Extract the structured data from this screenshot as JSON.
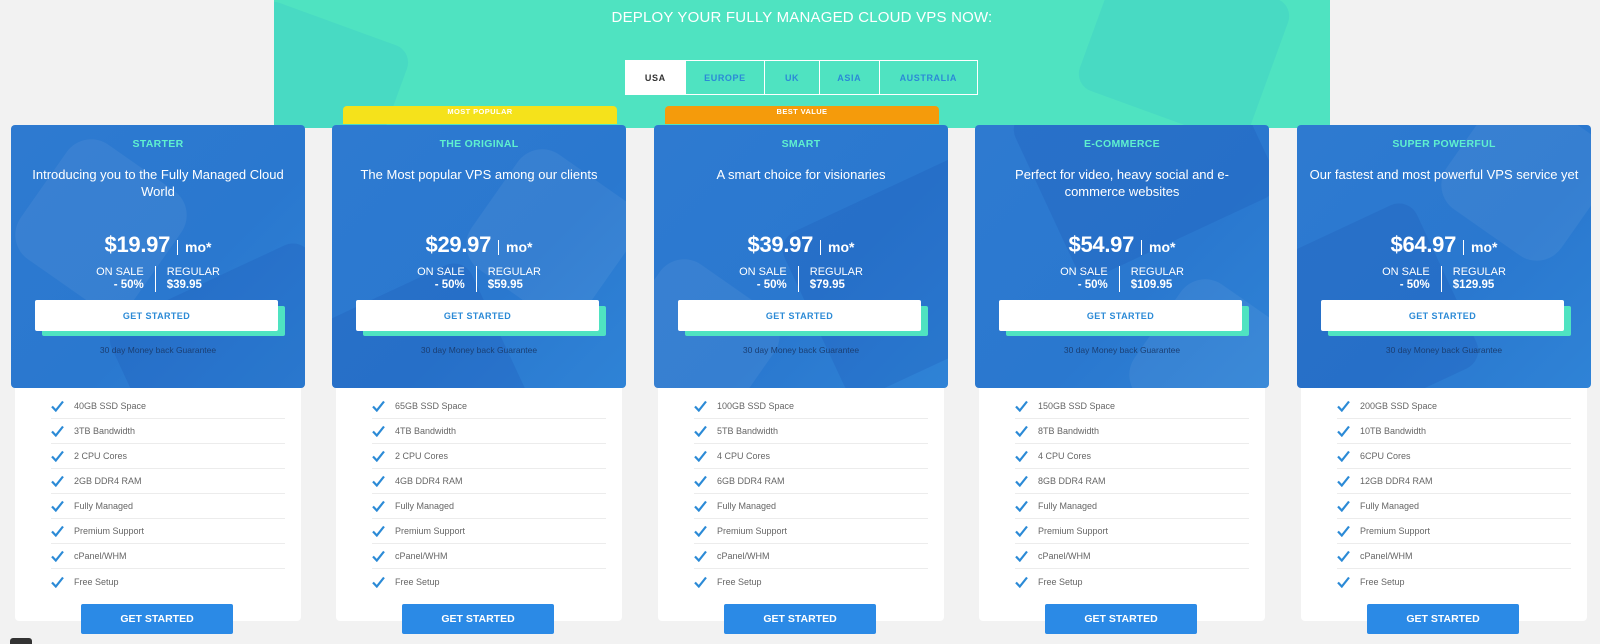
{
  "hero": {
    "title": "DEPLOY YOUR FULLY MANAGED CLOUD VPS NOW:",
    "tabs": [
      {
        "label": "USA",
        "active": true
      },
      {
        "label": "EUROPE",
        "active": false
      },
      {
        "label": "UK",
        "active": false
      },
      {
        "label": "ASIA",
        "active": false
      },
      {
        "label": "AUSTRALIA",
        "active": false
      }
    ]
  },
  "ribbons": {
    "popular": "MOST POPULAR",
    "best": "BEST VALUE"
  },
  "plans": [
    {
      "name": "STARTER",
      "tagline": "Introducing you to the Fully Managed Cloud World",
      "price": "$19.97",
      "mo": "mo*",
      "sale_label": "ON SALE",
      "sale_value": "- 50%",
      "regular_label": "REGULAR",
      "regular_value": "$39.95",
      "cta": "GET STARTED",
      "guarantee": "30 day Money back Guarantee",
      "features": [
        "40GB SSD Space",
        "3TB Bandwidth",
        "2 CPU Cores",
        "2GB DDR4 RAM",
        "Fully Managed",
        "Premium Support",
        "cPanel/WHM",
        "Free Setup"
      ],
      "bottom_cta": "GET STARTED"
    },
    {
      "name": "THE ORIGINAL",
      "tagline": "The Most popular VPS among our clients",
      "price": "$29.97",
      "mo": "mo*",
      "sale_label": "ON SALE",
      "sale_value": "- 50%",
      "regular_label": "REGULAR",
      "regular_value": "$59.95",
      "cta": "GET STARTED",
      "guarantee": "30 day Money back Guarantee",
      "features": [
        "65GB SSD Space",
        "4TB Bandwidth",
        "2 CPU Cores",
        "4GB DDR4 RAM",
        "Fully Managed",
        "Premium Support",
        "cPanel/WHM",
        "Free Setup"
      ],
      "bottom_cta": "GET STARTED"
    },
    {
      "name": "SMART",
      "tagline": "A smart choice for visionaries",
      "price": "$39.97",
      "mo": "mo*",
      "sale_label": "ON SALE",
      "sale_value": "- 50%",
      "regular_label": "REGULAR",
      "regular_value": "$79.95",
      "cta": "GET STARTED",
      "guarantee": "30 day Money back Guarantee",
      "features": [
        "100GB SSD Space",
        "5TB Bandwidth",
        "4 CPU Cores",
        "6GB DDR4 RAM",
        "Fully Managed",
        "Premium Support",
        "cPanel/WHM",
        "Free Setup"
      ],
      "bottom_cta": "GET STARTED"
    },
    {
      "name": "E-COMMERCE",
      "tagline": "Perfect for video, heavy social and e-commerce websites",
      "price": "$54.97",
      "mo": "mo*",
      "sale_label": "ON SALE",
      "sale_value": "- 50%",
      "regular_label": "REGULAR",
      "regular_value": "$109.95",
      "cta": "GET STARTED",
      "guarantee": "30 day Money back Guarantee",
      "features": [
        "150GB SSD Space",
        "8TB Bandwidth",
        "4 CPU Cores",
        "8GB DDR4 RAM",
        "Fully Managed",
        "Premium Support",
        "cPanel/WHM",
        "Free Setup"
      ],
      "bottom_cta": "GET STARTED"
    },
    {
      "name": "SUPER POWERFUL",
      "tagline": "Our fastest and most powerful VPS service yet",
      "price": "$64.97",
      "mo": "mo*",
      "sale_label": "ON SALE",
      "sale_value": "- 50%",
      "regular_label": "REGULAR",
      "regular_value": "$129.95",
      "cta": "GET STARTED",
      "guarantee": "30 day Money back Guarantee",
      "features": [
        "200GB SSD Space",
        "10TB Bandwidth",
        "6CPU Cores",
        "12GB DDR4 RAM",
        "Fully Managed",
        "Premium Support",
        "cPanel/WHM",
        "Free Setup"
      ],
      "bottom_cta": "GET STARTED"
    }
  ],
  "colors": {
    "hero_bg": "#4fe3c1",
    "card_blue": "#2a78cf",
    "plan_name": "#5ff0cf",
    "ribbon_popular": "#f5e21b",
    "ribbon_best": "#f59b0b",
    "cta_blue": "#2b8ae6",
    "check": "#2b8ad6"
  }
}
